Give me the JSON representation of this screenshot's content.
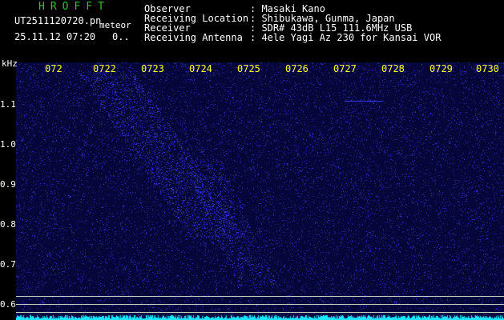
{
  "header": {
    "app_name": "HROFFT",
    "file_name": "UT2511120720.pn",
    "detection_label": "meteor",
    "timestamp": "25.11.12 07:20",
    "count": "0.."
  },
  "station_info": [
    {
      "label": "Observer",
      "value": ": Masaki Kano"
    },
    {
      "label": "Receiving Location",
      "value": ": Shibukawa, Gunma, Japan"
    },
    {
      "label": "Receiver",
      "value": ": SDR# 43dB L15 111.6MHz USB"
    },
    {
      "label": "Receiving Antenna",
      "value": ": 4ele Yagi Az 230 for Kansai VOR"
    }
  ],
  "spectrogram": {
    "y_unit": "kHz",
    "y_ticks": [
      "1.1",
      "1.0",
      "0.9",
      "0.8",
      "0.7",
      "0.6"
    ],
    "x_ticks": [
      "072",
      "0722",
      "0723",
      "0724",
      "0725",
      "0726",
      "0727",
      "0728",
      "0729",
      "0730"
    ],
    "background_color": "#05063a",
    "noise_color": "#3c3cff",
    "signal_color": "#19e6ff",
    "reference_line_color": "#c9c9c9"
  }
}
